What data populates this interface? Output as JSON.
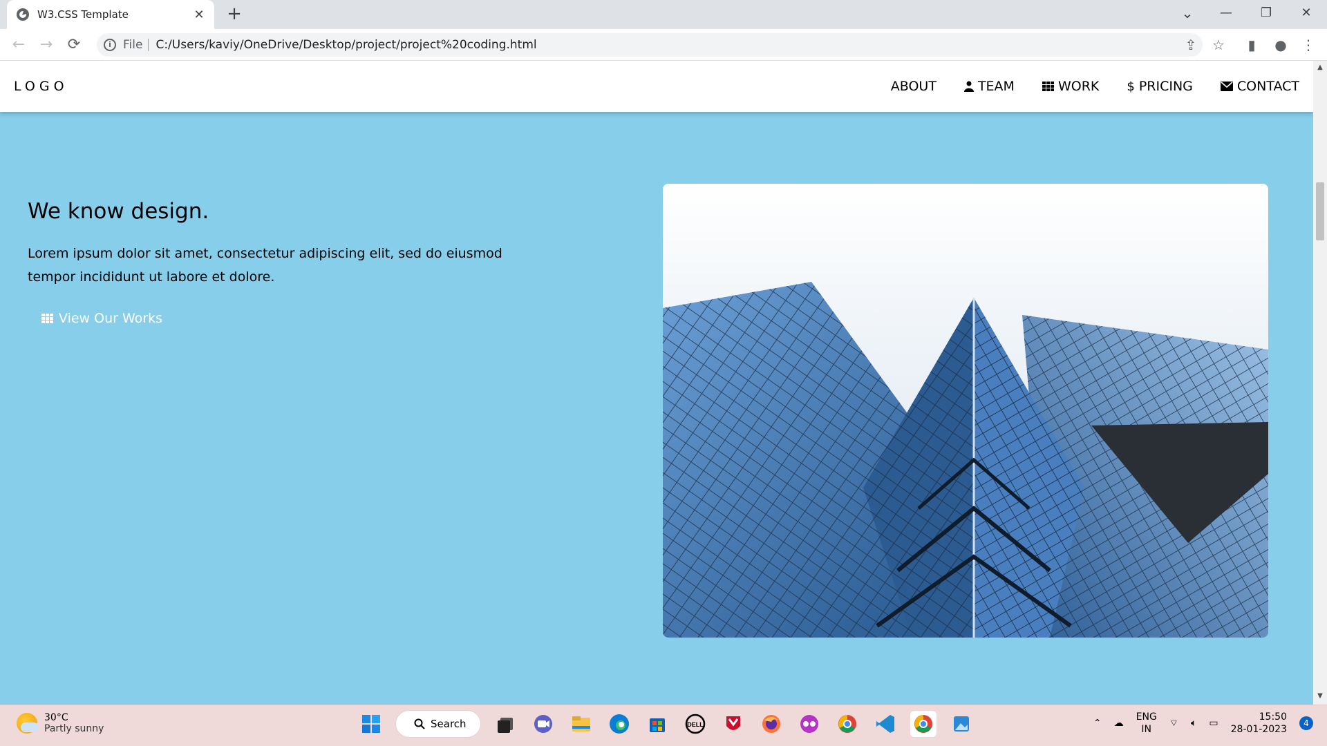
{
  "browser": {
    "tab_title": "W3.CSS Template",
    "tab_close": "✕",
    "new_tab": "+",
    "window_controls": [
      "⌄",
      "—",
      "❐",
      "✕"
    ],
    "back": "←",
    "forward": "→",
    "reload": "⟳",
    "info": "i",
    "scheme_label": "File",
    "url": "C:/Users/kaviy/OneDrive/Desktop/project/project%20coding.html",
    "right_icons": [
      "⇪",
      "☆",
      "▮",
      "●",
      "⋮"
    ]
  },
  "site": {
    "logo": "LOGO",
    "nav": [
      {
        "label": "ABOUT",
        "icon": ""
      },
      {
        "label": "TEAM",
        "icon": "user-icon"
      },
      {
        "label": "WORK",
        "icon": "grid-icon"
      },
      {
        "label": "PRICING",
        "icon": "dollar-icon"
      },
      {
        "label": "CONTACT",
        "icon": "envelope-icon"
      }
    ],
    "hero": {
      "title": "We know design.",
      "text": "Lorem ipsum dolor sit amet, consectetur adipiscing elit, sed do eiusmod tempor incididunt ut labore et dolore.",
      "button_label": "View Our Works"
    },
    "background_color": "#87ceeb"
  },
  "taskbar": {
    "weather_temp": "30°C",
    "weather_desc": "Partly sunny",
    "search_label": "Search",
    "lang_line1": "ENG",
    "lang_line2": "IN",
    "time": "15:50",
    "date": "28-01-2023",
    "notif_count": "4"
  }
}
